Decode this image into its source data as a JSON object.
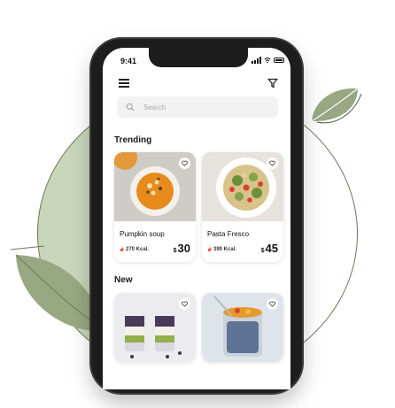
{
  "status_bar": {
    "time": "9:41"
  },
  "search": {
    "placeholder": "Search"
  },
  "sections": {
    "trending": "Trending",
    "new": "New"
  },
  "trending": [
    {
      "name": "Pumpkin soup",
      "kcal": "270 Kcal.",
      "currency": "$",
      "price": "30"
    },
    {
      "name": "Pasta Fresco",
      "kcal": "390 Kcal.",
      "currency": "$",
      "price": "45"
    }
  ],
  "icons": {
    "menu": "hamburger-menu-icon",
    "filter": "filter-funnel-icon",
    "search": "search-icon",
    "favorite": "heart-icon",
    "calories": "fire-icon"
  },
  "colors": {
    "accent": "#e8523a",
    "background_circle": "#c9d6ba",
    "leaf": "#98a882"
  }
}
